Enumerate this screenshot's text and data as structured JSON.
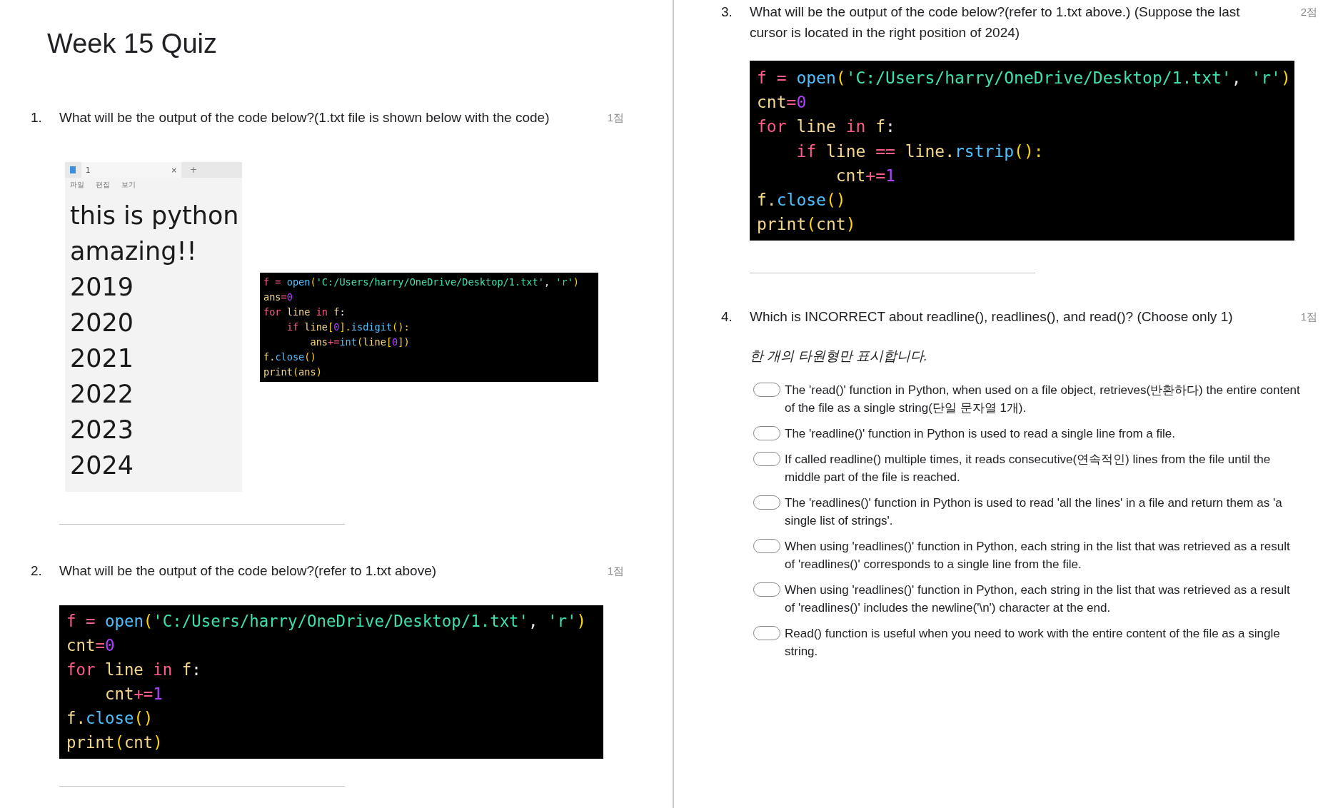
{
  "left_column": {
    "title": "Week 15 Quiz",
    "questions": [
      {
        "number": "1.",
        "text": "What will be the output of the code below?(1.txt file is shown below with the code)",
        "points": "1점",
        "notepad": {
          "tab": "1",
          "close": "×",
          "add": "+",
          "menu": [
            "파일",
            "편집",
            "보기"
          ],
          "lines": [
            "this is python",
            "amazing!!",
            "2019",
            "2020",
            "2021",
            "2022",
            "2023",
            "2024"
          ]
        },
        "code": [
          [
            {
              "t": "f",
              "kind": "kw"
            },
            {
              "t": " = ",
              "kind": "op"
            },
            {
              "t": "open",
              "kind": "fn"
            },
            {
              "t": "(",
              "kind": "br"
            },
            {
              "t": "'C:/Users/harry/OneDrive/Desktop/1.txt'",
              "kind": "str"
            },
            {
              "t": ", ",
              "kind": "plain"
            },
            {
              "t": "'r'",
              "kind": "str"
            },
            {
              "t": ")",
              "kind": "br"
            }
          ],
          [
            {
              "t": "ans",
              "kind": "var"
            },
            {
              "t": "=",
              "kind": "op"
            },
            {
              "t": "0",
              "kind": "num"
            }
          ],
          [
            {
              "t": "for",
              "kind": "kw"
            },
            {
              "t": " line ",
              "kind": "var"
            },
            {
              "t": "in",
              "kind": "kw"
            },
            {
              "t": " f",
              "kind": "var"
            },
            {
              "t": ":",
              "kind": "plain"
            }
          ],
          [
            {
              "t": "    if",
              "kind": "kw"
            },
            {
              "t": " line",
              "kind": "var"
            },
            {
              "t": "[",
              "kind": "br"
            },
            {
              "t": "0",
              "kind": "num"
            },
            {
              "t": "].",
              "kind": "br"
            },
            {
              "t": "isdigit",
              "kind": "fn"
            },
            {
              "t": "():",
              "kind": "br"
            }
          ],
          [
            {
              "t": "        ans",
              "kind": "var"
            },
            {
              "t": "+=",
              "kind": "op"
            },
            {
              "t": "int",
              "kind": "fn"
            },
            {
              "t": "(",
              "kind": "br"
            },
            {
              "t": "line",
              "kind": "var"
            },
            {
              "t": "[",
              "kind": "br"
            },
            {
              "t": "0",
              "kind": "num"
            },
            {
              "t": "])",
              "kind": "br"
            }
          ],
          [
            {
              "t": "f.",
              "kind": "var"
            },
            {
              "t": "close",
              "kind": "fn"
            },
            {
              "t": "()",
              "kind": "br"
            }
          ],
          [
            {
              "t": "print",
              "kind": "var"
            },
            {
              "t": "(",
              "kind": "br"
            },
            {
              "t": "ans",
              "kind": "var"
            },
            {
              "t": ")",
              "kind": "br"
            }
          ]
        ]
      },
      {
        "number": "2.",
        "text": "What will be the output of the code below?(refer to 1.txt above)",
        "points": "1점",
        "code": [
          [
            {
              "t": "f",
              "kind": "kw"
            },
            {
              "t": " = ",
              "kind": "op"
            },
            {
              "t": "open",
              "kind": "fn"
            },
            {
              "t": "(",
              "kind": "br"
            },
            {
              "t": "'C:/Users/harry/OneDrive/Desktop/1.txt'",
              "kind": "str"
            },
            {
              "t": ", ",
              "kind": "plain"
            },
            {
              "t": "'r'",
              "kind": "str"
            },
            {
              "t": ")",
              "kind": "br"
            }
          ],
          [
            {
              "t": "cnt",
              "kind": "var"
            },
            {
              "t": "=",
              "kind": "op"
            },
            {
              "t": "0",
              "kind": "num"
            }
          ],
          [
            {
              "t": "for",
              "kind": "kw"
            },
            {
              "t": " line ",
              "kind": "var"
            },
            {
              "t": "in",
              "kind": "kw"
            },
            {
              "t": " f",
              "kind": "var"
            },
            {
              "t": ":",
              "kind": "plain"
            }
          ],
          [
            {
              "t": "    cnt",
              "kind": "var"
            },
            {
              "t": "+=",
              "kind": "op"
            },
            {
              "t": "1",
              "kind": "num"
            }
          ],
          [
            {
              "t": "f.",
              "kind": "var"
            },
            {
              "t": "close",
              "kind": "fn"
            },
            {
              "t": "()",
              "kind": "br"
            }
          ],
          [
            {
              "t": "print",
              "kind": "var"
            },
            {
              "t": "(",
              "kind": "br"
            },
            {
              "t": "cnt",
              "kind": "var"
            },
            {
              "t": ")",
              "kind": "br"
            }
          ]
        ]
      }
    ]
  },
  "right_column": {
    "questions": [
      {
        "number": "3.",
        "text": "What will be the output of the code below?(refer to 1.txt above.) (Suppose the last cursor is located in the right position of 2024)",
        "points": "2점",
        "code": [
          [
            {
              "t": "f",
              "kind": "kw"
            },
            {
              "t": " = ",
              "kind": "op"
            },
            {
              "t": "open",
              "kind": "fn"
            },
            {
              "t": "(",
              "kind": "br"
            },
            {
              "t": "'C:/Users/harry/OneDrive/Desktop/1.txt'",
              "kind": "str"
            },
            {
              "t": ", ",
              "kind": "plain"
            },
            {
              "t": "'r'",
              "kind": "str"
            },
            {
              "t": ")",
              "kind": "br"
            }
          ],
          [
            {
              "t": "cnt",
              "kind": "var"
            },
            {
              "t": "=",
              "kind": "op"
            },
            {
              "t": "0",
              "kind": "num"
            }
          ],
          [
            {
              "t": "for",
              "kind": "kw"
            },
            {
              "t": " line ",
              "kind": "var"
            },
            {
              "t": "in",
              "kind": "kw"
            },
            {
              "t": " f",
              "kind": "var"
            },
            {
              "t": ":",
              "kind": "plain"
            }
          ],
          [
            {
              "t": "    if",
              "kind": "kw"
            },
            {
              "t": " line ",
              "kind": "var"
            },
            {
              "t": "==",
              "kind": "op"
            },
            {
              "t": " line.",
              "kind": "var"
            },
            {
              "t": "rstrip",
              "kind": "fn"
            },
            {
              "t": "():",
              "kind": "br"
            }
          ],
          [
            {
              "t": "        cnt",
              "kind": "var"
            },
            {
              "t": "+=",
              "kind": "op"
            },
            {
              "t": "1",
              "kind": "num"
            }
          ],
          [
            {
              "t": "f.",
              "kind": "var"
            },
            {
              "t": "close",
              "kind": "fn"
            },
            {
              "t": "()",
              "kind": "br"
            }
          ],
          [
            {
              "t": "print",
              "kind": "var"
            },
            {
              "t": "(",
              "kind": "br"
            },
            {
              "t": "cnt",
              "kind": "var"
            },
            {
              "t": ")",
              "kind": "br"
            }
          ]
        ]
      },
      {
        "number": "4.",
        "text": "Which is INCORRECT about readline(), readlines(), and read()? (Choose only 1)",
        "points": "1점",
        "hint": "한 개의 타원형만 표시합니다.",
        "options": [
          {
            "text": "The 'read()' function in Python, when used on a file object, retrieves(반환하다) the entire content of the file as a single string(단일 문자열 1개).",
            "selected": false
          },
          {
            "text": "The 'readline()' function in Python is used to read a single line from a file.",
            "selected": false
          },
          {
            "text": "If called readline() multiple times, it reads consecutive(연속적인) lines from the file until the middle part of the file is reached.",
            "selected": false
          },
          {
            "text": "The 'readlines()' function in Python is used to read 'all the lines' in a file and return them as 'a single list of strings'.",
            "selected": false
          },
          {
            "text": "When using 'readlines()' function in Python, each string in the list that was retrieved as a result of 'readlines()' corresponds to a single line from the file.",
            "selected": false
          },
          {
            "text": "When using 'readlines()' function in Python, each string in the list that was retrieved as a result of 'readlines()' includes the newline('\\n') character at the end.",
            "selected": false
          },
          {
            "text": "Read() function is useful when you need to work with the entire content of the file as a single string.",
            "selected": false
          }
        ]
      }
    ]
  }
}
